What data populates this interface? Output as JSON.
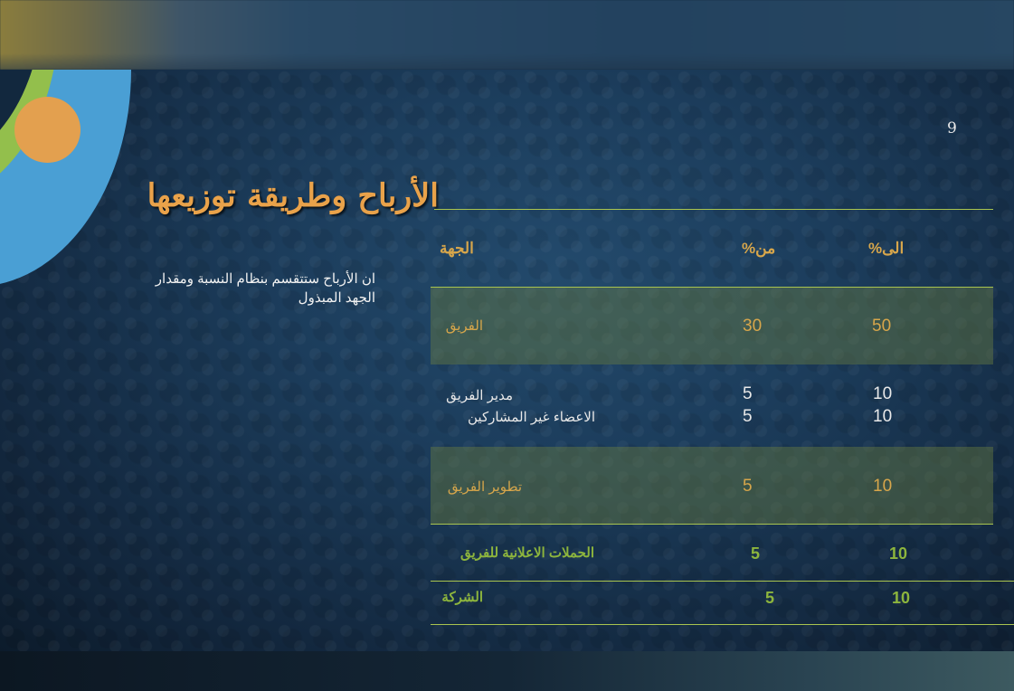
{
  "slide": {
    "page_number": "9",
    "title": "الأرباح وطريقة توزيعها",
    "body": "ان الأرباح ستتقسم بنظام النسبة ومقدار الجهد المبذول"
  },
  "table": {
    "headers": {
      "entity": "الجهة",
      "from": "%من",
      "to": "%الى"
    },
    "rows": [
      {
        "entity": "الفريق",
        "from": "30",
        "to": "50"
      },
      {
        "entity": "مدير الفريق",
        "from": "5",
        "to": "10"
      },
      {
        "entity": "الاعضاء غير المشاركين",
        "from": "5",
        "to": "10"
      },
      {
        "entity": "تطوير الفريق",
        "from": "5",
        "to": "10"
      },
      {
        "entity": "الحملات الاعلانية للفريق",
        "from": "5",
        "to": "10"
      },
      {
        "entity": "الشركة",
        "from": "5",
        "to": "10"
      }
    ]
  },
  "colors": {
    "accent_orange": "#e9a24a",
    "accent_green": "#a9c44f",
    "deco_blue": "#4a9fd4",
    "deco_green": "#93bf4c",
    "background": "#1c3d5c"
  }
}
